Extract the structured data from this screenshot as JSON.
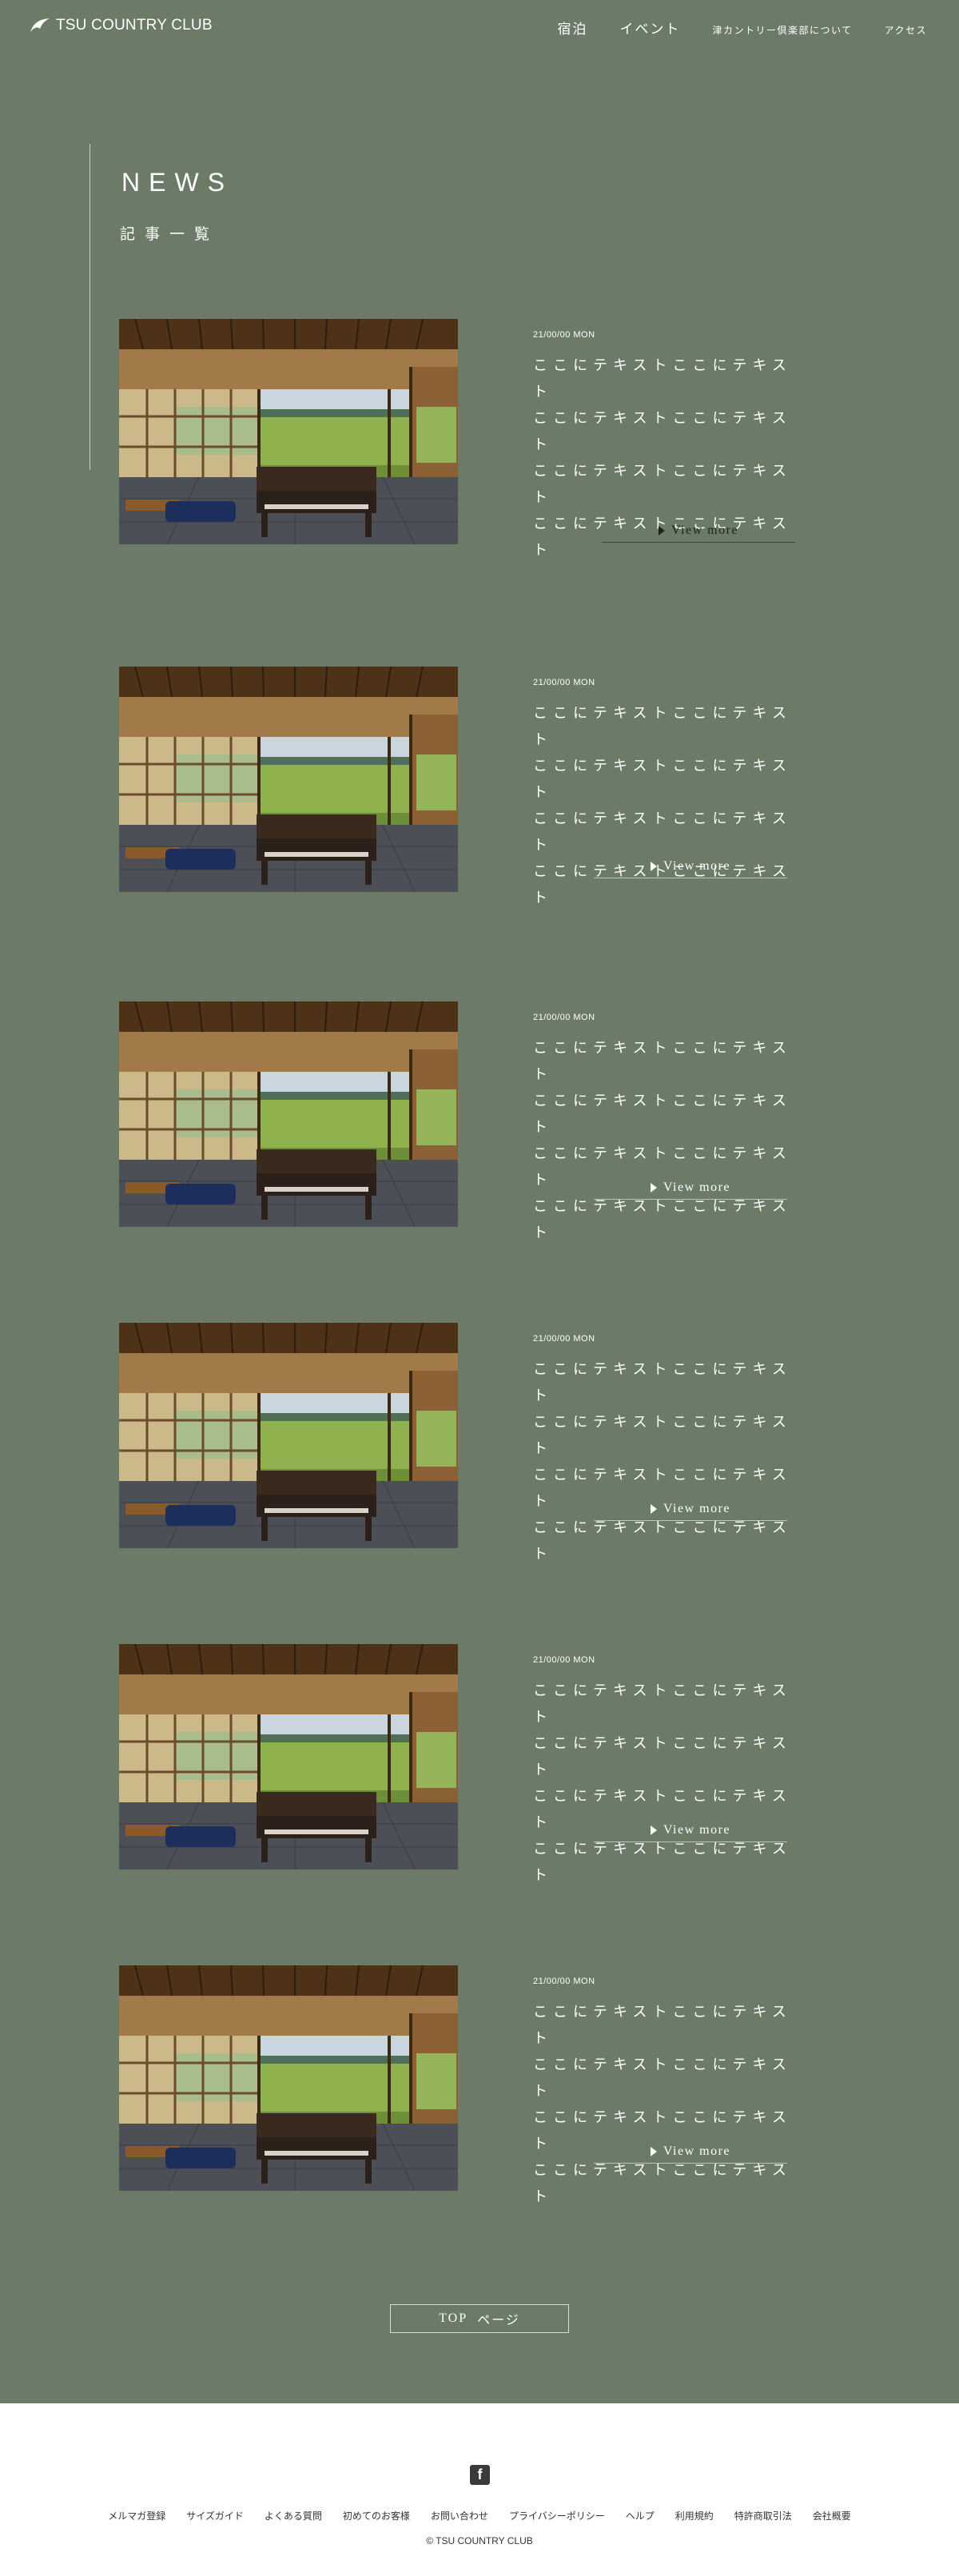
{
  "header": {
    "logo_text": "TSU COUNTRY CLUB",
    "nav": [
      {
        "label": "宿泊",
        "size": "big"
      },
      {
        "label": "イベント",
        "size": "big"
      },
      {
        "label": "津カントリー倶楽部について",
        "size": "small"
      },
      {
        "label": "アクセス",
        "size": "small"
      }
    ]
  },
  "section": {
    "title": "NEWS",
    "subtitle": "記事一覧"
  },
  "articles": [
    {
      "date": "21/00/00 MON",
      "lines": [
        "ここにテキストここにテキスト",
        "ここにテキストここにテキスト",
        "ここにテキストここにテキスト",
        "ここにテキストここにテキスト"
      ],
      "view_more": "View more"
    },
    {
      "date": "21/00/00 MON",
      "lines": [
        "ここにテキストここにテキスト",
        "ここにテキストここにテキスト",
        "ここにテキストここにテキスト",
        "ここにテキストここにテキスト"
      ],
      "view_more": "View more"
    },
    {
      "date": "21/00/00 MON",
      "lines": [
        "ここにテキストここにテキスト",
        "ここにテキストここにテキスト",
        "ここにテキストここにテキスト",
        "ここにテキストここにテキスト"
      ],
      "view_more": "View more"
    },
    {
      "date": "21/00/00 MON",
      "lines": [
        "ここにテキストここにテキスト",
        "ここにテキストここにテキスト",
        "ここにテキストここにテキスト",
        "ここにテキストここにテキスト"
      ],
      "view_more": "View more"
    },
    {
      "date": "21/00/00 MON",
      "lines": [
        "ここにテキストここにテキスト",
        "ここにテキストここにテキスト",
        "ここにテキストここにテキスト",
        "ここにテキストここにテキスト"
      ],
      "view_more": "View more"
    },
    {
      "date": "21/00/00 MON",
      "lines": [
        "ここにテキストここにテキスト",
        "ここにテキストここにテキスト",
        "ここにテキストここにテキスト",
        "ここにテキストここにテキスト"
      ],
      "view_more": "View more"
    }
  ],
  "top_button": {
    "label": "TOP",
    "suffix": "ページ"
  },
  "footer": {
    "social_icon": "facebook-icon",
    "links": [
      "メルマガ登録",
      "サイズガイド",
      "よくある質問",
      "初めてのお客様",
      "お問い合わせ",
      "プライバシーポリシー",
      "ヘルプ",
      "利用規約",
      "特許商取引法",
      "会社概要"
    ],
    "copyright": "© TSU COUNTRY CLUB"
  },
  "colors": {
    "background": "#6c7b68",
    "footer": "#ffffff",
    "text": "#ffffff"
  }
}
